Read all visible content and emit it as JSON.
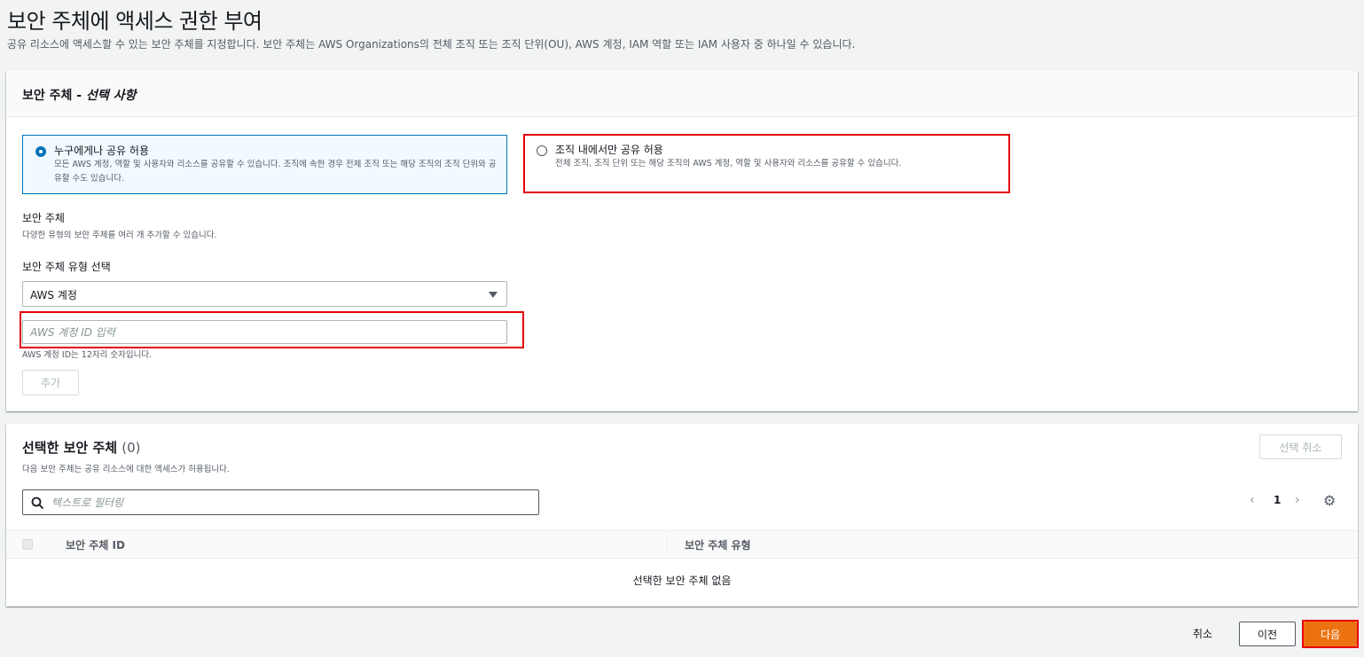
{
  "page": {
    "title": "보안 주체에 액세스 권한 부여",
    "description": "공유 리소스에 액세스할 수 있는 보안 주체를 지정합니다. 보안 주체는 AWS Organizations의 전체 조직 또는 조직 단위(OU), AWS 계정, IAM 역할 또는 IAM 사용자 중 하나일 수 있습니다."
  },
  "principals_panel": {
    "title": "보안 주체 - ",
    "title_optional": "선택 사항",
    "options": [
      {
        "title": "누구에게나 공유 허용",
        "description": "모든 AWS 계정, 역할 및 사용자와 리소스를 공유할 수 있습니다. 조직에 속한 경우 전체 조직 또는 해당 조직의 조직 단위와 공유할 수도 있습니다.",
        "selected": true
      },
      {
        "title": "조직 내에서만 공유 허용",
        "description": "전체 조직, 조직 단위 또는 해당 조직의 AWS 계정, 역할 및 사용자와 리소스를 공유할 수 있습니다.",
        "selected": false
      }
    ],
    "principal_label": "보안 주체",
    "principal_hint": "다양한 유형의 보안 주체를 여러 개 추가할 수 있습니다.",
    "type_label": "보안 주체 유형 선택",
    "type_value": "AWS 계정",
    "account_input_placeholder": "AWS 계정 ID 입력",
    "account_hint": "AWS 계정 ID는 12자리 숫자입니다.",
    "add_button": "추가"
  },
  "selected_panel": {
    "title": "선택한 보안 주체",
    "count": "(0)",
    "description": "다음 보안 주체는 공유 리소스에 대한 액세스가 허용됩니다.",
    "deselect_button": "선택 취소",
    "filter_placeholder": "텍스트로 필터링",
    "page_number": "1",
    "columns": [
      "보안 주체 ID",
      "보안 주체 유형"
    ],
    "empty_message": "선택한 보안 주체 없음"
  },
  "footer": {
    "cancel": "취소",
    "previous": "이전",
    "next": "다음"
  },
  "colors": {
    "primary": "#ec7211",
    "selected_border": "#0073bb",
    "highlight": "#e6000a"
  }
}
